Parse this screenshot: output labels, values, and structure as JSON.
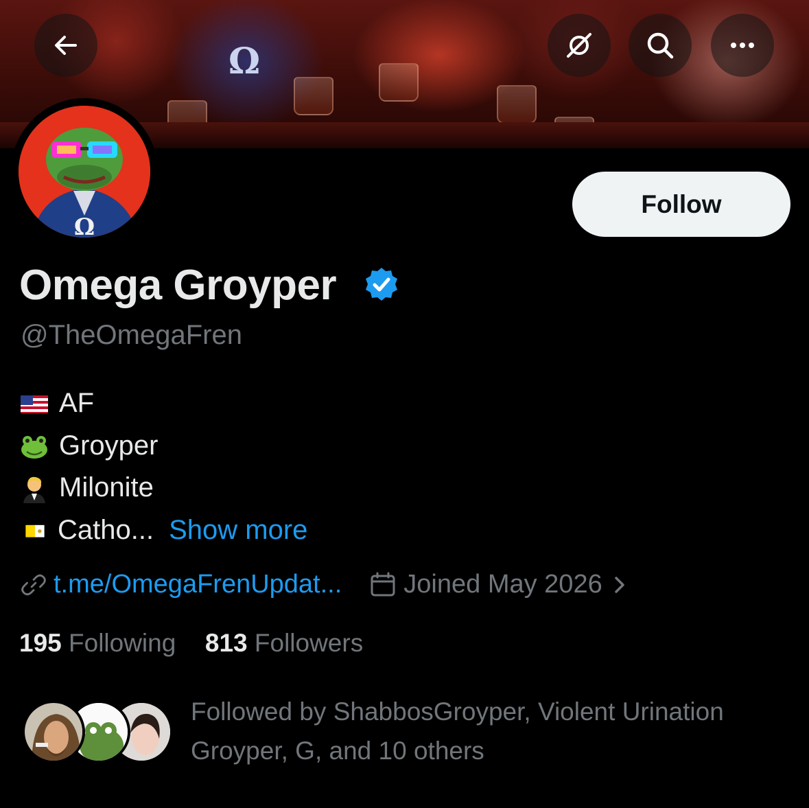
{
  "nav": {
    "back_icon": "arrow-left-icon",
    "grok_icon": "grok-icon",
    "search_icon": "search-icon",
    "more_icon": "more-dots-icon"
  },
  "profile": {
    "display_name": "Omega Groyper",
    "verified": true,
    "handle": "@TheOmegaFren",
    "follow_label": "Follow",
    "bio": [
      {
        "emoji": "us-flag",
        "text": "AF"
      },
      {
        "emoji": "frog",
        "text": "Groyper"
      },
      {
        "emoji": "person-in-tuxedo",
        "text": "Milonite"
      },
      {
        "emoji": "vatican-flag",
        "text": "Catho..."
      }
    ],
    "show_more_label": "Show more",
    "link_text": "t.me/OmegaFrenUpdat...",
    "joined_text": "Joined May 2026",
    "following_count": "195",
    "following_label": "Following",
    "followers_count": "813",
    "followers_label": "Followers",
    "followed_by_text": "Followed by ShabbosGroyper, Violent Urination Groyper, G, and 10 others"
  },
  "colors": {
    "accent": "#1d9bf0",
    "muted": "#71767b",
    "text": "#e7e9ea",
    "avatar_bg": "#e4321c",
    "follow_bg": "#eff3f4"
  }
}
